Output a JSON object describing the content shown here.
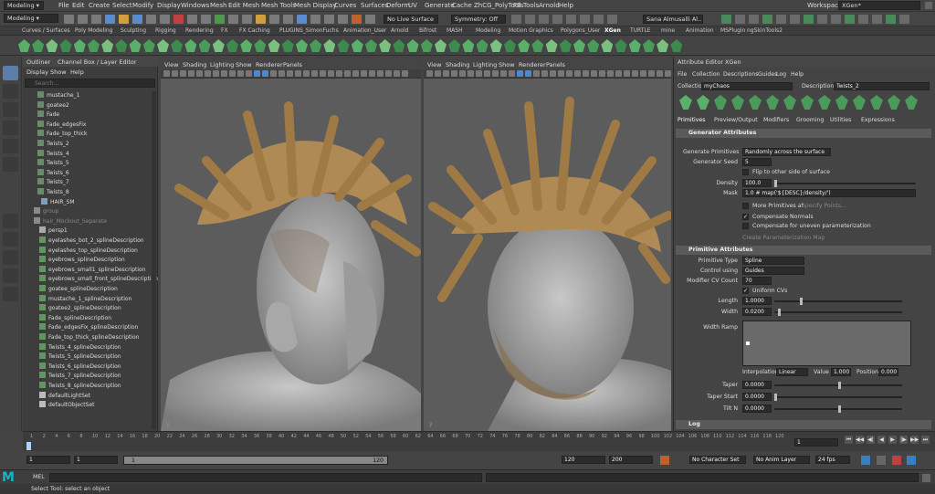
{
  "menubar": {
    "module": "Modeling",
    "items": [
      "File",
      "Edit",
      "Create",
      "Select",
      "Modify",
      "Display",
      "Windows",
      "Mesh",
      "Edit Mesh",
      "Mesh Tools",
      "Mesh Display",
      "Curves",
      "Surfaces",
      "Deform",
      "UV",
      "Generate",
      "Cache",
      "ZhCG_PolyTools",
      "FB Tools",
      "Arnold",
      "Help"
    ],
    "workspace_label": "Workspace :",
    "workspace_value": "XGen*"
  },
  "statusline": {
    "live_surface": "No Live Surface",
    "symmetry": "Symmetry: Off",
    "user": "Sana Almusalli Al..."
  },
  "shelf_tabs": [
    "Curves / Surfaces",
    "Poly Modeling",
    "Sculpting",
    "Rigging",
    "Rendering",
    "FX",
    "FX Caching",
    "PLUGINS_SimonFuchs",
    "Animation_User",
    "Arnold",
    "Bifrost",
    "MASH",
    "Modeling",
    "Motion Graphics",
    "Polygons_User",
    "XGen",
    "TURTLE",
    "mine",
    "Animation",
    "MSPlugin",
    "ngSkinTools2"
  ],
  "outliner": {
    "tabs": [
      "Outliner",
      "Channel Box / Layer Editor"
    ],
    "menu": [
      "Display",
      "Show",
      "Help"
    ],
    "search_placeholder": "Search...",
    "items": [
      "mustache_1",
      "goatee2",
      "Fade",
      "Fade_edgesFix",
      "Fade_top_thick",
      "Twists_2",
      "Twists_4",
      "Twists_5",
      "Twists_6",
      "Twists_7",
      "Twists_8",
      "HAIR_SM",
      "group",
      "hair_Mockout_Separate",
      "persp1",
      "eyelashes_bot_2_splineDescription",
      "eyelashes_top_splineDescription",
      "eyebrows_splineDescription",
      "eyebrows_small1_splineDescription",
      "eyebrows_small_front_splineDescription",
      "goatee_splineDescription",
      "mustache_1_splineDescription",
      "goatee2_splineDescription",
      "Fade_splineDescription",
      "Fade_edgesFix_splineDescription",
      "Fade_top_thick_splineDescription",
      "Twists_4_splineDescription",
      "Twists_5_splineDescription",
      "Twists_6_splineDescription",
      "Twists_7_splineDescription",
      "Twists_8_splineDescription",
      "defaultLightSet",
      "defaultObjectSet"
    ]
  },
  "viewport_menu": [
    "View",
    "Shading",
    "Lighting",
    "Show",
    "Renderer",
    "Panels"
  ],
  "attr": {
    "tabs": [
      "Attribute Editor",
      "XGen"
    ],
    "menu": [
      "File",
      "Collection",
      "Descriptions",
      "Guides",
      "Log",
      "Help"
    ],
    "collection_label": "Collection",
    "collection_value": "myChaos",
    "description_label": "Description",
    "description_value": "Twists_2",
    "subtabs": [
      "Primitives",
      "Preview/Output",
      "Modifiers",
      "Grooming",
      "Utilities",
      "Expressions"
    ],
    "gen_header": "Generator Attributes",
    "gen_primitives_label": "Generate Primitives",
    "gen_primitives_value": "Randomly across the surface",
    "gen_seed_label": "Generator Seed",
    "gen_seed_value": "5",
    "flip_label": "Flip to other side of surface",
    "density_label": "Density",
    "density_value": "100.0",
    "mask_label": "Mask",
    "mask_value": "1.0 # map('${DESC}/density/')",
    "more_primitives": "More Primitives at",
    "specify_points": "Specify Points...",
    "compensate_normals": "Compensate Normals",
    "compensate_uneven": "Compensate for uneven parameterization",
    "create_param_map": "Create Parameterization Map",
    "prim_header": "Primitive Attributes",
    "prim_type_label": "Primitive Type",
    "prim_type_value": "Spline",
    "control_label": "Control using",
    "control_value": "Guides",
    "cv_label": "Modifier CV Count",
    "cv_value": "70",
    "uniform_cvs": "Uniform CVs",
    "length_label": "Length",
    "length_value": "1.0000",
    "width_label": "Width",
    "width_value": "0.0200",
    "ramp_label": "Width Ramp",
    "interp_label": "Interpolation",
    "interp_value": "Linear",
    "value_label": "Value",
    "value_value": "1.000",
    "position_label": "Position",
    "position_value": "0.000",
    "taper_label": "Taper",
    "taper_value": "0.0000",
    "taper_start_label": "Taper Start",
    "taper_start_value": "0.0000",
    "tiltn_label": "Tilt N",
    "tiltn_value": "0.0000",
    "log_header": "Log"
  },
  "timeline": {
    "ticks": [
      "1",
      "2",
      "4",
      "6",
      "8",
      "10",
      "12",
      "14",
      "16",
      "18",
      "20",
      "22",
      "24",
      "26",
      "28",
      "30",
      "32",
      "34",
      "36",
      "38",
      "40",
      "42",
      "44",
      "46",
      "48",
      "50",
      "52",
      "54",
      "56",
      "58",
      "60",
      "62",
      "64",
      "66",
      "68",
      "70",
      "72",
      "74",
      "76",
      "78",
      "80",
      "82",
      "84",
      "86",
      "88",
      "90",
      "92",
      "94",
      "96",
      "98",
      "100",
      "102",
      "104",
      "106",
      "108",
      "110",
      "112",
      "114",
      "116",
      "118",
      "120"
    ],
    "current": "1"
  },
  "range": {
    "start": "1",
    "start2": "1",
    "inner_start": "1",
    "inner_end": "120",
    "end": "120",
    "end2": "200",
    "character_set": "No Character Set",
    "anim_layer": "No Anim Layer",
    "fps": "24 fps"
  },
  "cmdline": {
    "label": "MEL"
  },
  "helpline": {
    "text": "Select Tool: select an object"
  }
}
